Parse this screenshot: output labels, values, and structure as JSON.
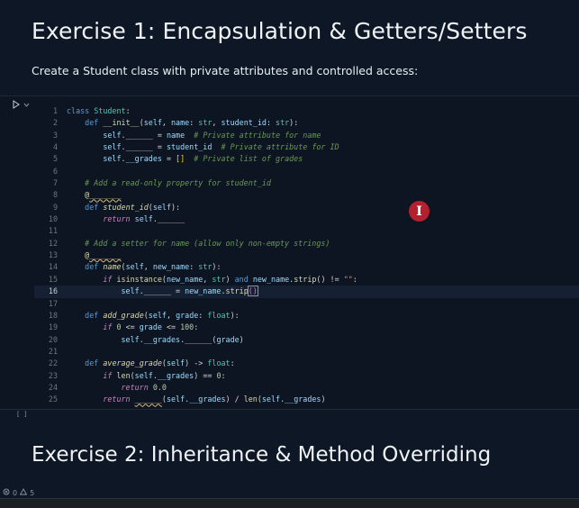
{
  "heading1": "Exercise 1: Encapsulation & Getters/Setters",
  "description": "Create a Student class with private attributes and controlled access:",
  "cell": {
    "exec_count": "[ ]"
  },
  "heading2": "Exercise 2: Inheritance & Method Overriding",
  "status_bar": {
    "errors": "0",
    "warnings": "5"
  },
  "code_lines": [
    {
      "n": "1"
    },
    {
      "n": "2"
    },
    {
      "n": "3"
    },
    {
      "n": "4"
    },
    {
      "n": "5"
    },
    {
      "n": "6"
    },
    {
      "n": "7"
    },
    {
      "n": "8"
    },
    {
      "n": "9"
    },
    {
      "n": "10"
    },
    {
      "n": "11"
    },
    {
      "n": "12"
    },
    {
      "n": "13"
    },
    {
      "n": "14"
    },
    {
      "n": "15"
    },
    {
      "n": "16"
    },
    {
      "n": "17"
    },
    {
      "n": "18"
    },
    {
      "n": "19"
    },
    {
      "n": "20"
    },
    {
      "n": "21"
    },
    {
      "n": "22"
    },
    {
      "n": "23"
    },
    {
      "n": "24"
    },
    {
      "n": "25"
    }
  ],
  "code": {
    "l1": [
      "class",
      " ",
      "Student",
      ":"
    ],
    "l2": [
      "    ",
      "def",
      " ",
      "__init__",
      "(",
      "self",
      ", ",
      "name",
      ": ",
      "str",
      ", ",
      "student_id",
      ": ",
      "str",
      "):"
    ],
    "l3": [
      "        ",
      "self",
      ".",
      "______",
      " = ",
      "name",
      "  ",
      "# Private attribute for name"
    ],
    "l4": [
      "        ",
      "self",
      ".",
      "______",
      " = ",
      "student_id",
      "  ",
      "# Private attribute for ID"
    ],
    "l5": [
      "        ",
      "self",
      ".",
      "__grades",
      " = ",
      "[]",
      "  ",
      "# Private list of grades"
    ],
    "l7": [
      "    ",
      "# Add a read-only property for student_id"
    ],
    "l8": [
      "    ",
      "@",
      "_______"
    ],
    "l9": [
      "    ",
      "def",
      " ",
      "student_id",
      "(",
      "self",
      "):"
    ],
    "l10": [
      "        ",
      "return",
      " ",
      "self",
      ".",
      "______"
    ],
    "l12": [
      "    ",
      "# Add a setter for name (allow only non-empty strings)"
    ],
    "l13": [
      "    ",
      "@",
      "_______"
    ],
    "l14": [
      "    ",
      "def",
      " ",
      "name",
      "(",
      "self",
      ", ",
      "new_name",
      ": ",
      "str",
      "):"
    ],
    "l15": [
      "        ",
      "if",
      " ",
      "isinstance",
      "(",
      "new_name",
      ", ",
      "str",
      ") ",
      "and",
      " ",
      "new_name",
      ".",
      "strip",
      "() != ",
      "\"\"",
      ":"
    ],
    "l16": [
      "            ",
      "self",
      ".",
      "______",
      " = ",
      "new_name",
      ".",
      "strip",
      "()"
    ],
    "l18": [
      "    ",
      "def",
      " ",
      "add_grade",
      "(",
      "self",
      ", ",
      "grade",
      ": ",
      "float",
      "):"
    ],
    "l19": [
      "        ",
      "if",
      " ",
      "0",
      " <= ",
      "grade",
      " <= ",
      "100",
      ":"
    ],
    "l20": [
      "            ",
      "self",
      ".",
      "__grades",
      ".",
      "______",
      "(",
      "grade",
      ")"
    ],
    "l22": [
      "    ",
      "def",
      " ",
      "average_grade",
      "(",
      "self",
      ") -> ",
      "float",
      ":"
    ],
    "l23": [
      "        ",
      "if",
      " ",
      "len",
      "(",
      "self",
      ".",
      "__grades",
      ") == ",
      "0",
      ":"
    ],
    "l24": [
      "            ",
      "return",
      " ",
      "0.0"
    ],
    "l25": [
      "        ",
      "return",
      " ",
      "______",
      "(",
      "self",
      ".",
      "__grades",
      ") / ",
      "len",
      "(",
      "self",
      ".",
      "__grades",
      ")"
    ]
  },
  "colors": {
    "background": "#0e1726",
    "cell_bg": "#0d1522",
    "cursor_badge": "#b3202e"
  },
  "icons": [
    "run-icon",
    "chevron-down-icon",
    "error-icon",
    "warning-icon",
    "text-cursor-icon"
  ]
}
